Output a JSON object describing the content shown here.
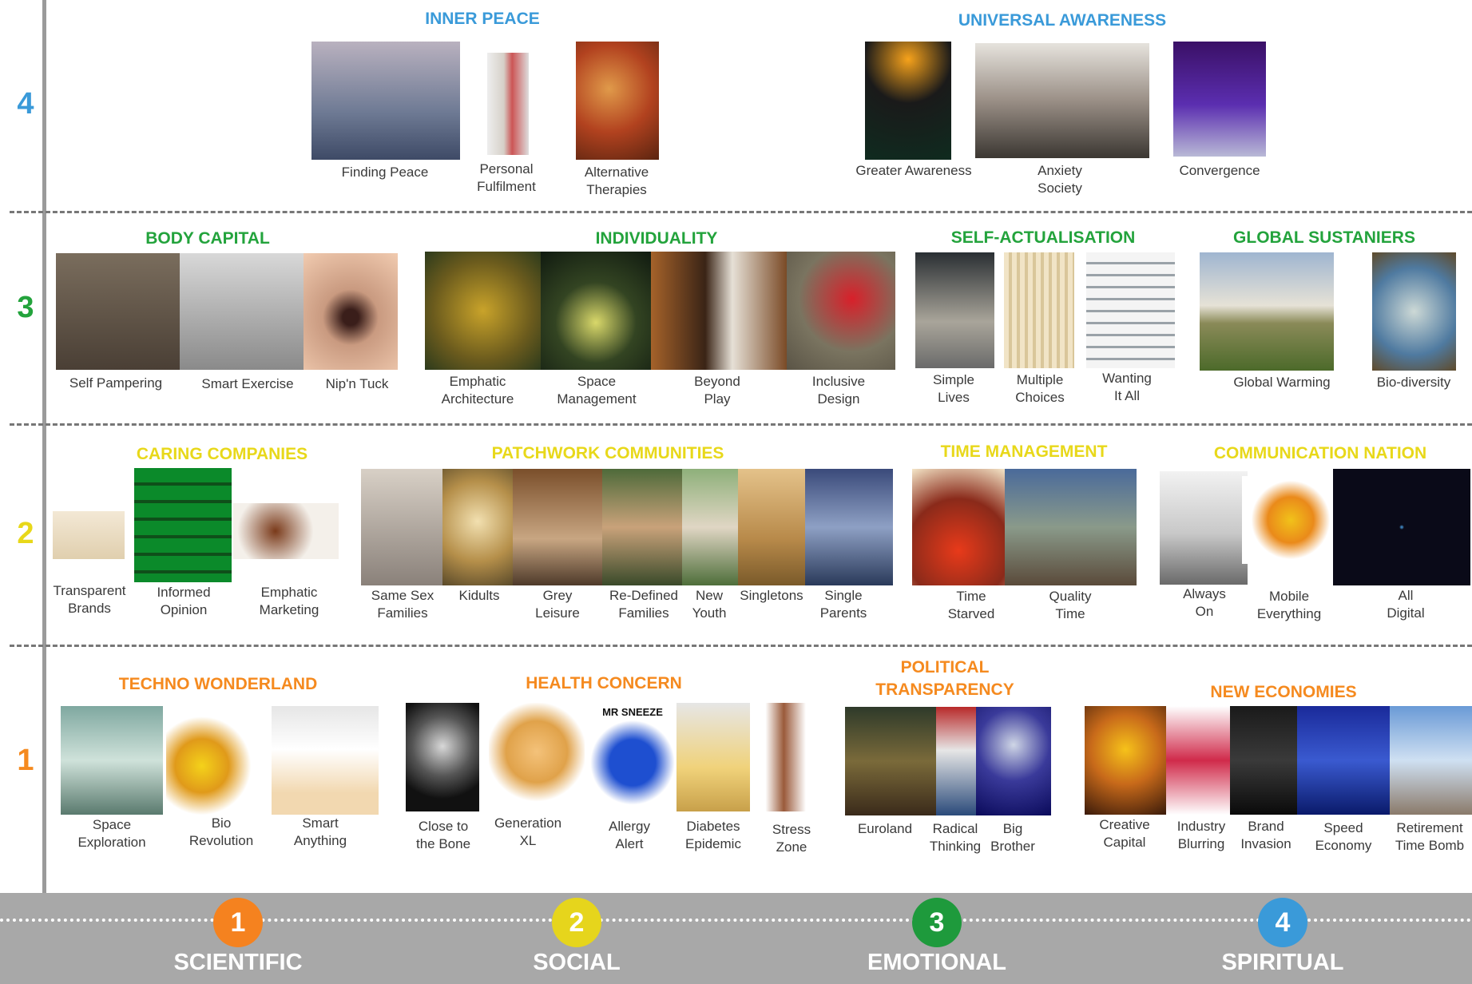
{
  "colors": {
    "level_1": "#f58a1f",
    "level_2": "#e8d81a",
    "level_3": "#23a33c",
    "level_4": "#3a9ad9",
    "bottom_bar": "#a8a8a8"
  },
  "levels": [
    "1",
    "2",
    "3",
    "4"
  ],
  "categories": [
    {
      "number": "1",
      "label": "SCIENTIFIC",
      "color": "#f5821f"
    },
    {
      "number": "2",
      "label": "SOCIAL",
      "color": "#e6d51c"
    },
    {
      "number": "3",
      "label": "EMOTIONAL",
      "color": "#1e9a3c"
    },
    {
      "number": "4",
      "label": "SPIRITUAL",
      "color": "#3a9ad9"
    }
  ],
  "sections": [
    {
      "title": "INNER PEACE",
      "color": "#3a9ad9",
      "level": "4",
      "items": [
        {
          "label": "Finding Peace",
          "image": "lake-at-dusk"
        },
        {
          "label": "Personal\nFulfilment",
          "image": "spray-can"
        },
        {
          "label": "Alternative\nTherapies",
          "image": "praying-monks"
        }
      ]
    },
    {
      "title": "UNIVERSAL AWARENESS",
      "color": "#3a9ad9",
      "level": "4",
      "items": [
        {
          "label": "Greater Awareness",
          "image": "plant-poster"
        },
        {
          "label": "Anxiety\nSociety",
          "image": "gas-mask-crowd"
        },
        {
          "label": "Convergence",
          "image": "purple-screen"
        }
      ]
    },
    {
      "title": "BODY CAPITAL",
      "color": "#23a33c",
      "level": "3",
      "items": [
        {
          "label": "Self Pampering",
          "image": "family-tent"
        },
        {
          "label": "Smart Exercise",
          "image": "gymnasts"
        },
        {
          "label": "Nip'n Tuck",
          "image": "face-closeup"
        }
      ]
    },
    {
      "title": "INDIVIDUALITY",
      "color": "#23a33c",
      "level": "3",
      "items": [
        {
          "label": "Emphatic\nArchitecture",
          "image": "spiky-building"
        },
        {
          "label": "Space\nManagement",
          "image": "lit-house"
        },
        {
          "label": "Beyond\nPlay",
          "image": "children-playing"
        },
        {
          "label": "Inclusive\nDesign",
          "image": "red-chair"
        }
      ]
    },
    {
      "title": "SELF-ACTUALISATION",
      "color": "#23a33c",
      "level": "3",
      "items": [
        {
          "label": "Simple\nLives",
          "image": "stone-doorway"
        },
        {
          "label": "Multiple\nChoices",
          "image": "coffee-cups"
        },
        {
          "label": "Wanting\nIt All",
          "image": "shelving"
        }
      ]
    },
    {
      "title": "GLOBAL SUSTANIERS",
      "color": "#23a33c",
      "level": "3",
      "items": [
        {
          "label": "Global Warming",
          "image": "huts-in-field"
        },
        {
          "label": "Bio-diversity",
          "image": "butterfly-collage"
        }
      ]
    },
    {
      "title": "CARING COMPANIES",
      "color": "#e8d81a",
      "level": "2",
      "items": [
        {
          "label": "Transparent\nBrands",
          "image": "soap-bar"
        },
        {
          "label": "Informed\nOpinion",
          "image": "green-seats"
        },
        {
          "label": "Emphatic\nMarketing",
          "image": "teapot-set"
        }
      ]
    },
    {
      "title": "PATCHWORK COMMUNITIES",
      "color": "#e8d81a",
      "level": "2",
      "items": [
        {
          "label": "Same Sex\nFamilies",
          "image": "couple-photo"
        },
        {
          "label": "Kidults",
          "image": "blonde-girl"
        },
        {
          "label": "Grey\nLeisure",
          "image": "elderly-couple"
        },
        {
          "label": "Re-Defined\nFamilies",
          "image": "family-group"
        },
        {
          "label": "New\nYouth",
          "image": "boy-outdoors"
        },
        {
          "label": "Singletons",
          "image": "person-in-room"
        },
        {
          "label": "Single\nParents",
          "image": "kids-on-sofa"
        }
      ]
    },
    {
      "title": "TIME MANAGEMENT",
      "color": "#e8d81a",
      "level": "2",
      "items": [
        {
          "label": "Time\nStarved",
          "image": "red-dining-hall"
        },
        {
          "label": "Quality\nTime",
          "image": "wooden-cabin"
        }
      ]
    },
    {
      "title": "COMMUNICATION NATION",
      "color": "#e8d81a",
      "level": "2",
      "items": [
        {
          "label": "Always\nOn",
          "image": "computer-room"
        },
        {
          "label": "Mobile\nEverything",
          "image": "mobile-device"
        },
        {
          "label": "All\nDigital",
          "image": "screen-wall"
        }
      ]
    },
    {
      "title": "TECHNO WONDERLAND",
      "color": "#f58a1f",
      "level": "1",
      "items": [
        {
          "label": "Space\nExploration",
          "image": "astronaut"
        },
        {
          "label": "Bio\nRevolution",
          "image": "apple-halves"
        },
        {
          "label": "Smart\nAnything",
          "image": "hand-device"
        }
      ]
    },
    {
      "title": "HEALTH CONCERN",
      "color": "#f58a1f",
      "level": "1",
      "items": [
        {
          "label": "Close to\nthe Bone",
          "image": "hand-xray"
        },
        {
          "label": "Generation\nXL",
          "image": "doll"
        },
        {
          "label": "Allergy\nAlert",
          "image": "mr-sneeze-book",
          "caption": "MR SNEEZE"
        },
        {
          "label": "Diabetes\nEpidemic",
          "image": "syringe"
        },
        {
          "label": "Stress\nZone",
          "image": "foot-on-scale"
        }
      ]
    },
    {
      "title": "POLITICAL\nTRANSPARENCY",
      "color": "#f58a1f",
      "level": "1",
      "items": [
        {
          "label": "Euroland",
          "image": "pub-crowd"
        },
        {
          "label": "Radical\nThinking",
          "image": "magazine-collage"
        },
        {
          "label": "Big\nBrother",
          "image": "binocular-viewer"
        }
      ]
    },
    {
      "title": "NEW ECONOMIES",
      "color": "#f58a1f",
      "level": "1",
      "items": [
        {
          "label": "Creative\nCapital",
          "image": "golden-hall"
        },
        {
          "label": "Industry\nBlurring",
          "image": "logo-collage"
        },
        {
          "label": "Brand\nInvasion",
          "image": "dark-storefront"
        },
        {
          "label": "Speed\nEconomy",
          "image": "blue-pier"
        },
        {
          "label": "Retirement\nTime Bomb",
          "image": "couple-on-deck"
        }
      ]
    }
  ]
}
